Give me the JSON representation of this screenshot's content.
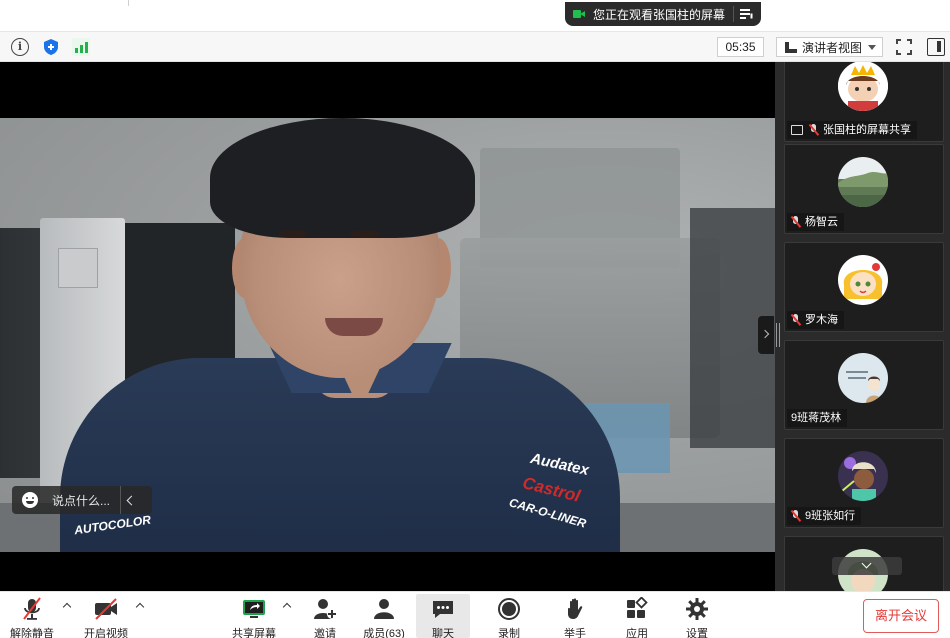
{
  "banner": {
    "text": "您正在观看张国柱的屏幕"
  },
  "toolbar": {
    "timer": "05:35",
    "view_label": "演讲者视图"
  },
  "video": {
    "logos": [
      "Audatex",
      "Castrol",
      "CAR-O-LINER",
      "AUTOCOLOR"
    ]
  },
  "chat": {
    "placeholder": "说点什么..."
  },
  "participants": [
    {
      "name": "张国柱的屏幕共享",
      "avatar": "cartoon-king",
      "muted": true,
      "screen": true
    },
    {
      "name": "杨智云",
      "avatar": "landscape",
      "muted": true,
      "screen": false
    },
    {
      "name": "罗木海",
      "avatar": "cartoon-girl",
      "muted": true,
      "screen": false
    },
    {
      "name": "9班蒋茂林",
      "avatar": "cartoon-sketch",
      "muted": false,
      "screen": false
    },
    {
      "name": "9班张如行",
      "avatar": "cartoon-hero",
      "muted": true,
      "screen": false
    }
  ],
  "controls": {
    "unmute": "解除静音",
    "start_video": "开启视频",
    "share_screen": "共享屏幕",
    "invite": "邀请",
    "members": "成员(63)",
    "chat": "聊天",
    "record": "录制",
    "raise_hand": "举手",
    "apps": "应用",
    "settings": "设置",
    "leave": "离开会议"
  },
  "colors": {
    "leave_red": "#e53935",
    "banner_green": "#1fbf4f",
    "signal_green": "#23b14d",
    "muted_red": "#e53935"
  }
}
